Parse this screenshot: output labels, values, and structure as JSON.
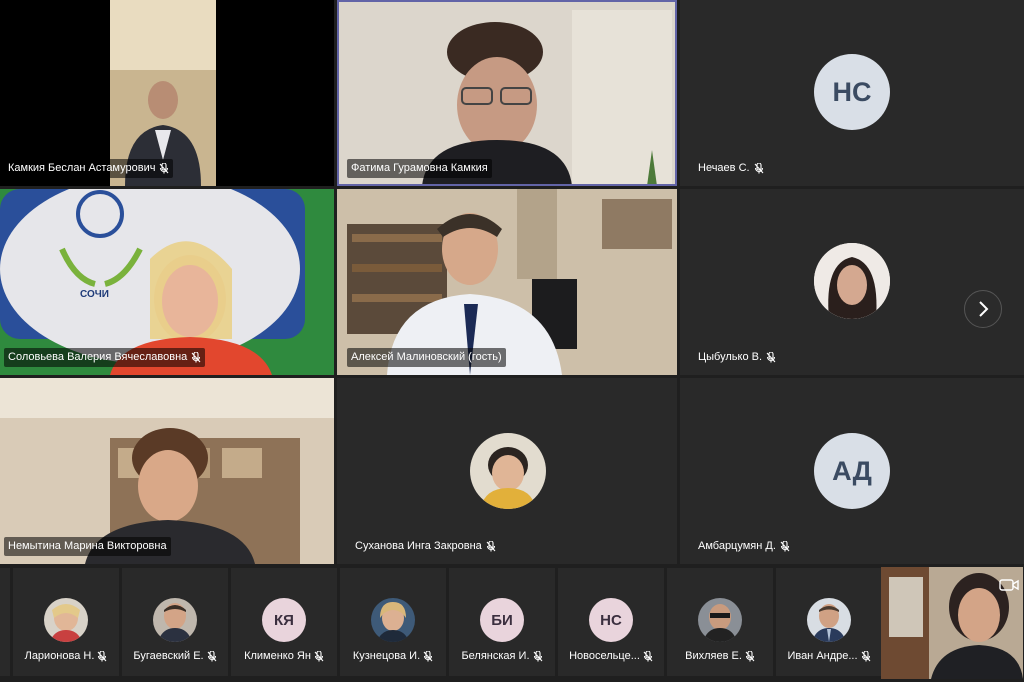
{
  "gallery": {
    "tiles": [
      {
        "name": "Камкия Беслан Астамурович",
        "muted": true,
        "kind": "video"
      },
      {
        "name": "Фатима Гурамовна Камкия",
        "muted": false,
        "kind": "video",
        "active": true
      },
      {
        "name": "Нечаев С.",
        "muted": true,
        "kind": "initials",
        "initials": "НС"
      },
      {
        "name": "Соловьева Валерия Вячеславовна",
        "muted": true,
        "kind": "video",
        "logo_text": "СОЧИ"
      },
      {
        "name": "Алексей Малиновский (гость)",
        "muted": false,
        "kind": "video"
      },
      {
        "name": "Цыбулько В.",
        "muted": true,
        "kind": "photo"
      },
      {
        "name": "Немытина Марина Викторовна",
        "muted": false,
        "kind": "video"
      },
      {
        "name": "Суханова Инга Закровна",
        "muted": true,
        "kind": "photo"
      },
      {
        "name": "Амбарцумян Д.",
        "muted": true,
        "kind": "initials",
        "initials": "АД"
      }
    ]
  },
  "strip": {
    "items": [
      {
        "name": "Ларионова Н.",
        "muted": true,
        "kind": "photo"
      },
      {
        "name": "Бугаевский Е.",
        "muted": true,
        "kind": "photo"
      },
      {
        "name": "Клименко Ян",
        "muted": true,
        "kind": "initials",
        "initials": "КЯ"
      },
      {
        "name": "Кузнецова И.",
        "muted": true,
        "kind": "photo"
      },
      {
        "name": "Белянская И.",
        "muted": true,
        "kind": "initials",
        "initials": "БИ"
      },
      {
        "name": "Новосельце...",
        "muted": true,
        "kind": "initials",
        "initials": "НС"
      },
      {
        "name": "Вихляев Е.",
        "muted": true,
        "kind": "photo"
      },
      {
        "name": "Иван Андре...",
        "muted": true,
        "kind": "photo"
      }
    ]
  },
  "colors": {
    "background": "#1f1f1f",
    "tile": "#292929",
    "active_border": "#6264a7",
    "avatar_bg": "#d9dfe7",
    "avatar_text": "#3b4b62"
  },
  "icons": {
    "mic_off": "mic-off-icon",
    "next": "chevron-right-icon"
  }
}
